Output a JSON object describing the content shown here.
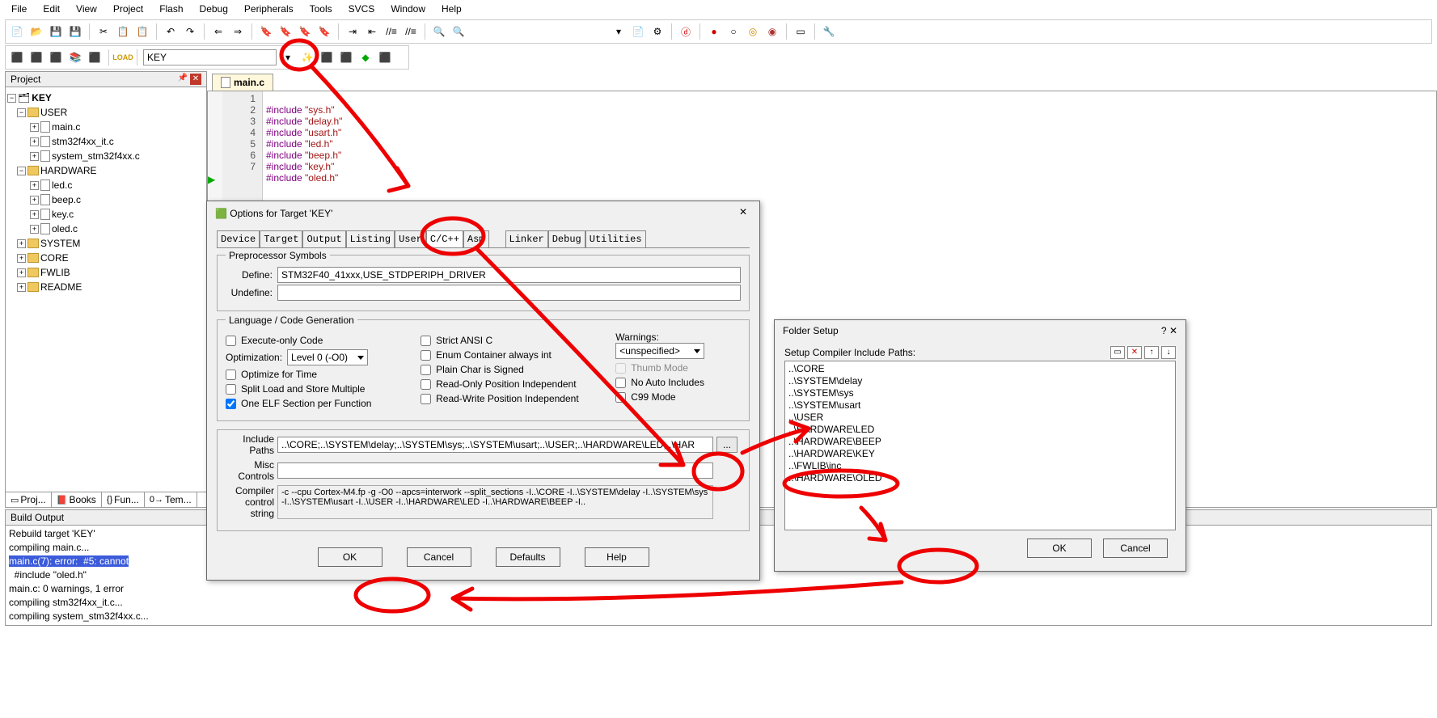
{
  "menu": [
    "File",
    "Edit",
    "View",
    "Project",
    "Flash",
    "Debug",
    "Peripherals",
    "Tools",
    "SVCS",
    "Window",
    "Help"
  ],
  "toolbar2": {
    "target": "KEY"
  },
  "project": {
    "title": "Project",
    "root": "KEY",
    "folders": {
      "user": "USER",
      "user_files": [
        "main.c",
        "stm32f4xx_it.c",
        "system_stm32f4xx.c"
      ],
      "hardware": "HARDWARE",
      "hw_files": [
        "led.c",
        "beep.c",
        "key.c",
        "oled.c"
      ],
      "others": [
        "SYSTEM",
        "CORE",
        "FWLIB",
        "README"
      ]
    },
    "tabs": [
      "Proj...",
      "Books",
      "Fun...",
      "Tem..."
    ]
  },
  "editor": {
    "tab": "main.c",
    "lines": [
      {
        "n": "1",
        "code": "#include \"sys.h\""
      },
      {
        "n": "2",
        "code": "#include \"delay.h\""
      },
      {
        "n": "3",
        "code": "#include \"usart.h\""
      },
      {
        "n": "4",
        "code": "#include \"led.h\""
      },
      {
        "n": "5",
        "code": "#include \"beep.h\""
      },
      {
        "n": "6",
        "code": "#include \"key.h\""
      },
      {
        "n": "7",
        "code": "#include \"oled.h\""
      }
    ]
  },
  "build": {
    "title": "Build Output",
    "lines": [
      "Rebuild target 'KEY'",
      "compiling main.c...",
      "main.c(7): error:  #5: cannot",
      "  #include \"oled.h\"",
      "main.c: 0 warnings, 1 error",
      "compiling stm32f4xx_it.c...",
      "compiling system_stm32f4xx.c..."
    ]
  },
  "dialog": {
    "title": "Options for Target 'KEY'",
    "tabs": [
      "Device",
      "Target",
      "Output",
      "Listing",
      "User",
      "C/C++",
      "Asm",
      "Linker",
      "Debug",
      "Utilities"
    ],
    "preproc": {
      "legend": "Preprocessor Symbols",
      "define_label": "Define:",
      "define": "STM32F40_41xxx,USE_STDPERIPH_DRIVER",
      "undefine_label": "Undefine:"
    },
    "lang": {
      "legend": "Language / Code Generation",
      "exec_only": "Execute-only Code",
      "opt_label": "Optimization:",
      "opt_value": "Level 0 (-O0)",
      "opt_time": "Optimize for Time",
      "split_load": "Split Load and Store Multiple",
      "one_elf": "One ELF Section per Function",
      "strict": "Strict ANSI C",
      "enum": "Enum Container always int",
      "plain_char": "Plain Char is Signed",
      "ro_pos": "Read-Only Position Independent",
      "rw_pos": "Read-Write Position Independent",
      "warn_label": "Warnings:",
      "warn_value": "<unspecified>",
      "thumb": "Thumb Mode",
      "no_auto": "No Auto Includes",
      "c99": "C99 Mode"
    },
    "include": {
      "label": "Include Paths",
      "value": "..\\CORE;..\\SYSTEM\\delay;..\\SYSTEM\\sys;..\\SYSTEM\\usart;..\\USER;..\\HARDWARE\\LED;..\\HAR"
    },
    "misc": {
      "label": "Misc Controls"
    },
    "compiler": {
      "label": "Compiler control string",
      "value": "-c --cpu Cortex-M4.fp -g -O0 --apcs=interwork --split_sections -I..\\CORE -I..\\SYSTEM\\delay -I..\\SYSTEM\\sys -I..\\SYSTEM\\usart -I..\\USER -I..\\HARDWARE\\LED -I..\\HARDWARE\\BEEP -I.."
    },
    "buttons": {
      "ok": "OK",
      "cancel": "Cancel",
      "defaults": "Defaults",
      "help": "Help"
    }
  },
  "folder_setup": {
    "title": "Folder Setup",
    "label": "Setup Compiler Include Paths:",
    "paths": [
      "..\\CORE",
      "..\\SYSTEM\\delay",
      "..\\SYSTEM\\sys",
      "..\\SYSTEM\\usart",
      "..\\USER",
      "..\\HARDWARE\\LED",
      "..\\HARDWARE\\BEEP",
      "..\\HARDWARE\\KEY",
      "..\\FWLIB\\inc",
      "..\\HARDWARE\\OLED"
    ],
    "ok": "OK",
    "cancel": "Cancel"
  }
}
